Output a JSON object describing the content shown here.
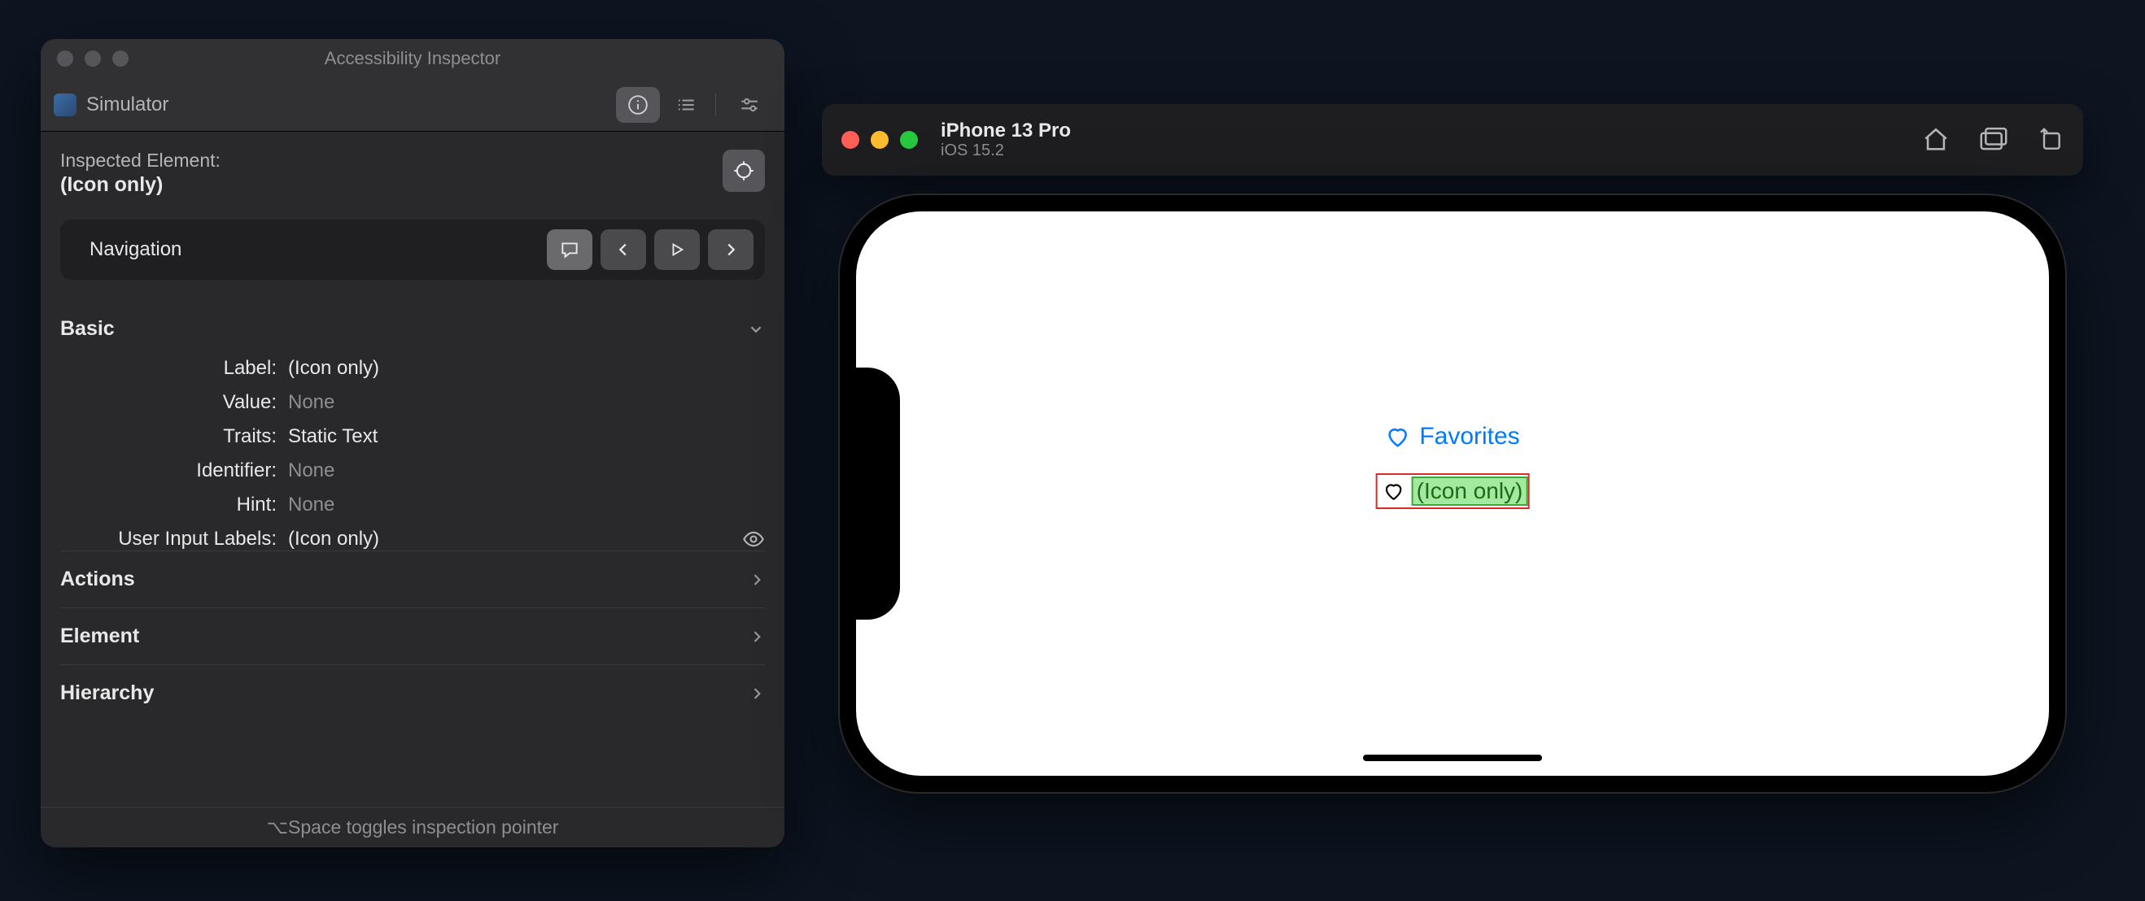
{
  "inspector": {
    "window_title": "Accessibility Inspector",
    "target_app": "Simulator",
    "inspected_element_label": "Inspected Element:",
    "inspected_element_value": "(Icon only)",
    "nav_label": "Navigation",
    "basic": {
      "title": "Basic",
      "rows": {
        "label_k": "Label:",
        "label_v": "(Icon only)",
        "value_k": "Value:",
        "value_v": "None",
        "traits_k": "Traits:",
        "traits_v": "Static Text",
        "identifier_k": "Identifier:",
        "identifier_v": "None",
        "hint_k": "Hint:",
        "hint_v": "None",
        "uil_k": "User Input Labels:",
        "uil_v": "(Icon only)"
      }
    },
    "sections": {
      "actions": "Actions",
      "element": "Element",
      "hierarchy": "Hierarchy"
    },
    "footer_hint": "⌥Space toggles inspection pointer"
  },
  "simulator": {
    "device": "iPhone 13 Pro",
    "os": "iOS 15.2",
    "app": {
      "favorites_label": "Favorites",
      "icon_only_label": "(Icon only)"
    }
  }
}
